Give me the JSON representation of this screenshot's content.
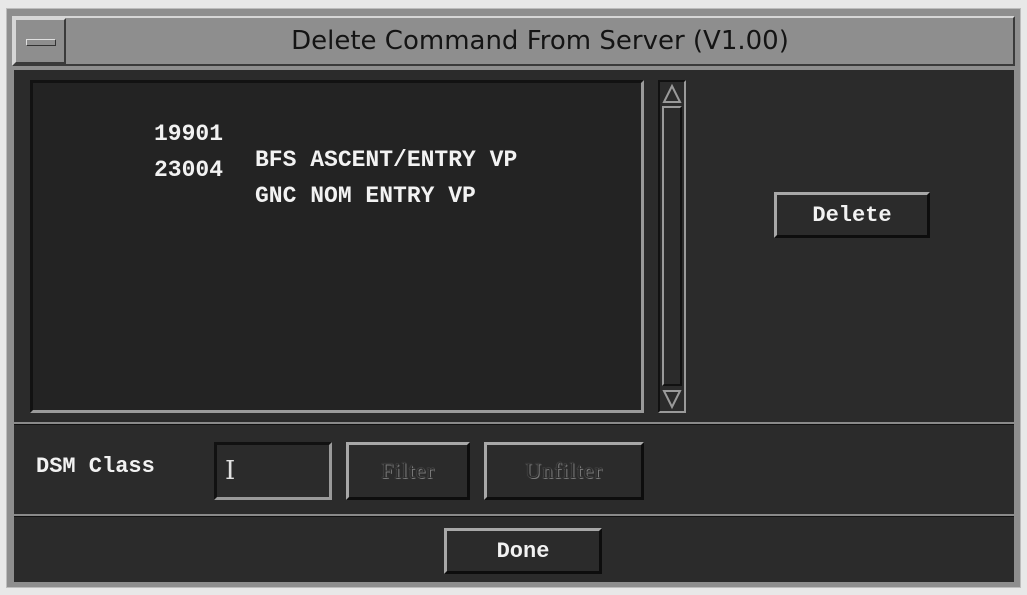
{
  "window": {
    "title": "Delete Command From Server (V1.00)"
  },
  "command_list": {
    "items": [
      {
        "id": "19901",
        "name": "BFS ASCENT/ENTRY VP"
      },
      {
        "id": "23004",
        "name": "GNC NOM ENTRY VP"
      }
    ]
  },
  "buttons": {
    "delete": "Delete",
    "filter": "Filter",
    "unfilter": "Unfilter",
    "done": "Done"
  },
  "filter_row": {
    "label": "DSM Class",
    "value": ""
  },
  "colors": {
    "background": "#2b2b2b",
    "titlebar": "#8e8e8e",
    "text": "#f2f2f2"
  }
}
